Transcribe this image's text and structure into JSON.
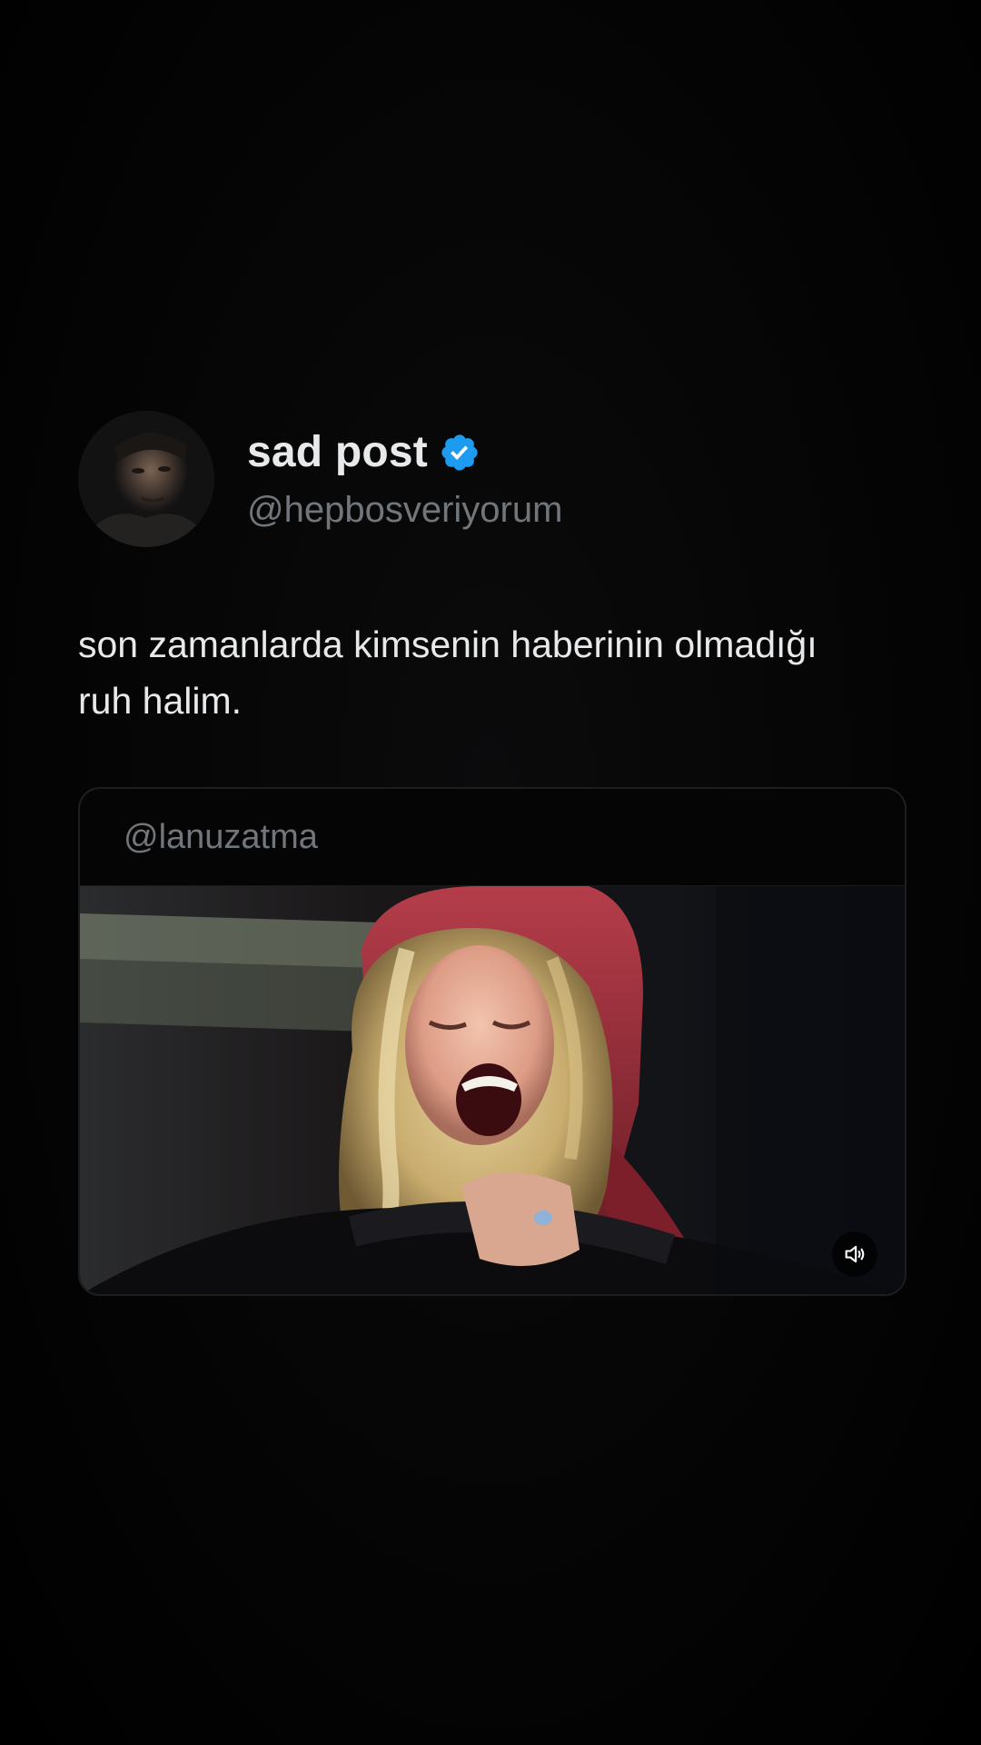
{
  "post": {
    "author": {
      "display_name": "sad post",
      "handle": "@hepbosveriyorum",
      "verified": true,
      "avatar_icon": "profile-avatar"
    },
    "text": "son zamanlarda kimsenin haberinin olmadığı ruh halim."
  },
  "quote": {
    "handle": "@lanuzatma",
    "media": {
      "type": "video",
      "volume_icon": "volume-icon"
    }
  },
  "colors": {
    "background": "#000000",
    "primary_text": "#e7e9ea",
    "secondary_text": "#71767b",
    "verified_blue": "#1d9bf0",
    "card_border": "#1c1e21"
  }
}
